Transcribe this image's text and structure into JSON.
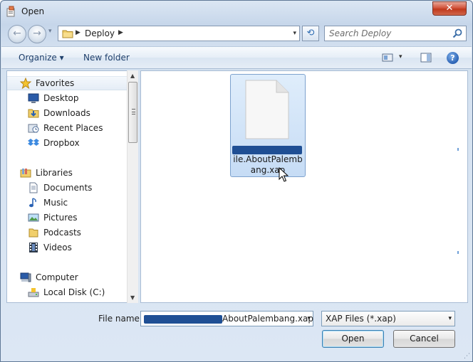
{
  "window": {
    "title": "Open",
    "close_glyph": "✕",
    "app_icon": "open-dialog-icon"
  },
  "navigation": {
    "back_glyph": "←",
    "forward_glyph": "→",
    "recent_glyph": "▾",
    "breadcrumb": "Deploy",
    "chevron": "▶",
    "dropdown_glyph": "▾",
    "refresh_glyph": "⟲"
  },
  "search": {
    "placeholder": "Search Deploy",
    "icon": "search-icon"
  },
  "toolbar": {
    "organize_label": "Organize ▾",
    "new_folder_label": "New folder",
    "view_dropdown": "▾",
    "help_label": "?"
  },
  "sidebar": {
    "favorites": {
      "label": "Favorites",
      "items": [
        {
          "label": "Desktop",
          "icon": "desktop-icon"
        },
        {
          "label": "Downloads",
          "icon": "downloads-icon"
        },
        {
          "label": "Recent Places",
          "icon": "recent-places-icon"
        },
        {
          "label": "Dropbox",
          "icon": "dropbox-icon"
        }
      ]
    },
    "libraries": {
      "label": "Libraries",
      "items": [
        {
          "label": "Documents",
          "icon": "documents-icon"
        },
        {
          "label": "Music",
          "icon": "music-icon"
        },
        {
          "label": "Pictures",
          "icon": "pictures-icon"
        },
        {
          "label": "Podcasts",
          "icon": "podcasts-icon"
        },
        {
          "label": "Videos",
          "icon": "videos-icon"
        }
      ]
    },
    "computer": {
      "label": "Computer",
      "items": [
        {
          "label": "Local Disk (C:)",
          "icon": "local-disk-icon"
        }
      ]
    },
    "scroll_up": "▲",
    "scroll_down": "▼"
  },
  "files": [
    {
      "name": "ile.AboutPalembang.xap",
      "icon": "generic-file-icon",
      "selected": true
    }
  ],
  "footer": {
    "file_name_label": "File name:",
    "file_name_value": "AboutPalembang.xap",
    "file_name_dropdown": "▾",
    "file_type": "XAP Files (*.xap)",
    "file_type_dropdown": "▾",
    "open_label": "Open",
    "cancel_label": "Cancel",
    "resize_grip": "⋰"
  }
}
